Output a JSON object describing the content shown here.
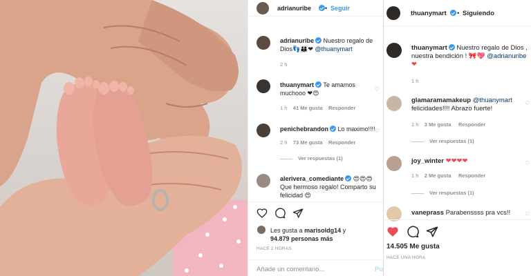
{
  "post": {
    "author": "adrianuribe",
    "follow_label": "Seguir",
    "caption_user": "adrianuribe",
    "caption_text": "Nuestro regalo de Dios👣👨‍👩‍👦❤",
    "caption_mention": "@thuanymart",
    "caption_time": "2 h",
    "comments": [
      {
        "user": "thuanymart",
        "text": "Te amamos muchooo ❤😍",
        "time": "1 h",
        "likes": "41 Me gusta",
        "reply": "Responder"
      },
      {
        "user": "penichebrandon",
        "text": "Lo maximo!!!!",
        "time": "2 h",
        "likes": "73 Me gusta",
        "reply": "Responder",
        "view_replies": "Ver respuestas (1)"
      },
      {
        "user": "alerivera_comediante",
        "text": "😍😍😍 Que hermoso regalo! Comparto su felicidad 😍"
      }
    ],
    "liked_by_prefix": "Les gusta a",
    "liked_by_user": "marisoldg14",
    "liked_by_suffix": "y",
    "liked_by_count": "94.879 personas más",
    "post_age": "HACE 2 HORAS",
    "comment_placeholder": "Añade un comentario...",
    "publish_label": "Pu"
  },
  "post2": {
    "author": "thuanymart",
    "follow_state": "Siguiendo",
    "caption_user": "thuanymart",
    "caption_text": "Nuestro regalo de Dios , nuestra bendición ! 🎀💖",
    "caption_mention": "@adrianuribe",
    "caption_heart": "❤",
    "caption_time": "1 h",
    "comments": [
      {
        "user": "glamaramamakeup",
        "mention": "@thuanymart",
        "text": "felicidades!!!! Abrazo fuerte!",
        "time": "1 h",
        "likes": "3 Me gusta",
        "reply": "Responder",
        "view_replies": "Ver respuestas (1)"
      },
      {
        "user": "joy_winter",
        "text": "❤❤❤❤",
        "time": "1 h",
        "likes": "2 Me gusta",
        "reply": "Responder",
        "view_replies": "Ver respuestas (1)"
      },
      {
        "user": "vaneprass",
        "text": "Parabenssss pra vcs!!"
      }
    ],
    "likes_count": "14.505 Me gusta",
    "post_age": "HACE UNA HORA"
  },
  "colors": {
    "accent": "#3897f0",
    "liked": "#ed4956",
    "muted": "#8e8e8e"
  }
}
